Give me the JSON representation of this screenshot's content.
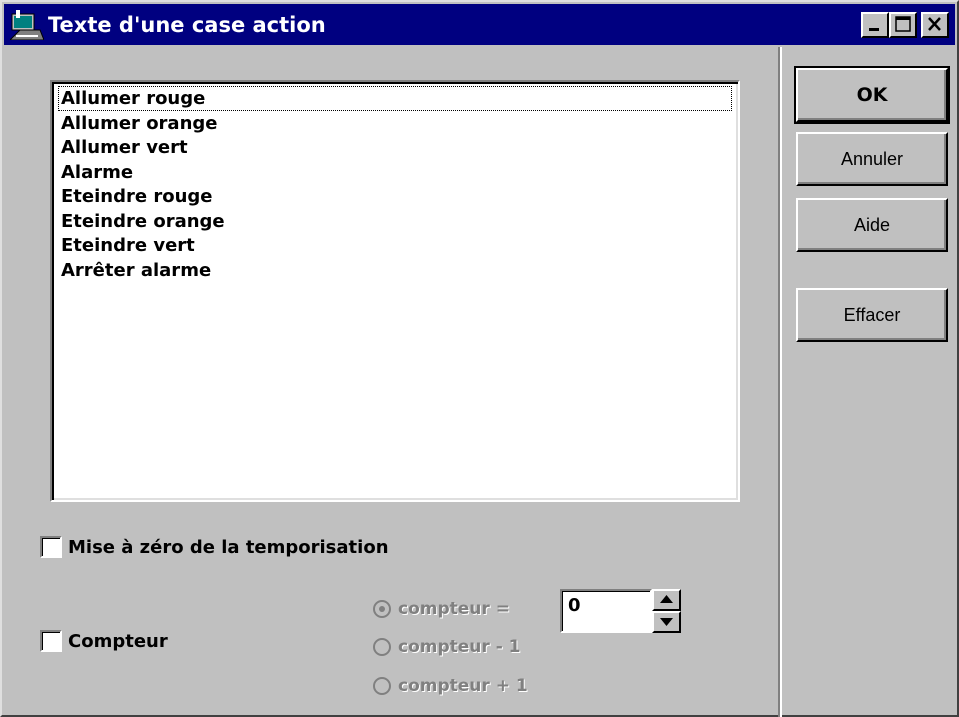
{
  "window": {
    "title": "Texte d'une case action",
    "icon": "app-window-icon",
    "controls": [
      "minimize-icon",
      "maximize-icon",
      "close-icon"
    ]
  },
  "actions_list": {
    "items": [
      "Allumer rouge",
      "Allumer orange",
      "Allumer vert",
      "Alarme",
      "Eteindre rouge",
      "Eteindre orange",
      "Eteindre vert",
      "Arrêter alarme"
    ],
    "focused_index": 0
  },
  "buttons": {
    "ok": "OK",
    "cancel": "Annuler",
    "help": "Aide",
    "clear": "Effacer"
  },
  "timer_reset": {
    "label": "Mise à zéro de la temporisation",
    "checked": false
  },
  "counter": {
    "label": "Compteur",
    "checked": false,
    "options": [
      "compteur =",
      "compteur - 1",
      "compteur + 1"
    ],
    "selected_option": 0,
    "value": "0"
  },
  "colors": {
    "titlebar": "#000080",
    "face": "#c0c0c0",
    "disabled_text": "#808080"
  }
}
